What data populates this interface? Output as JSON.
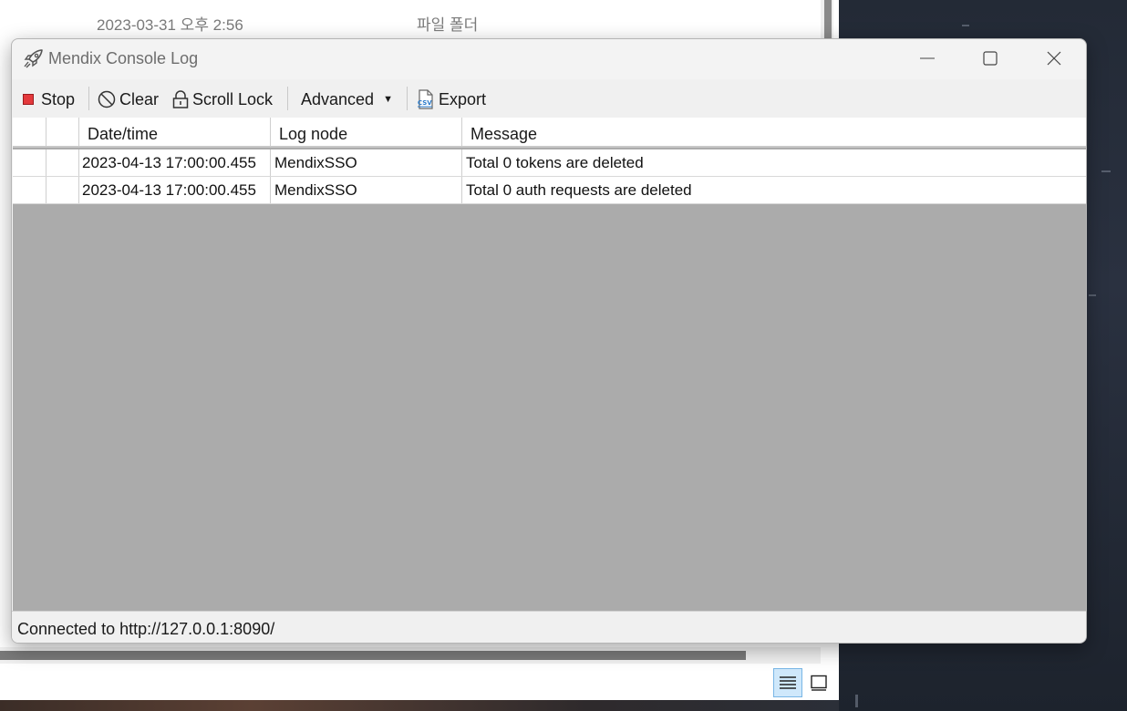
{
  "background": {
    "explorer_row": {
      "date": "2023-03-31 오후 2:56",
      "type": "파일 폴더"
    }
  },
  "window": {
    "title": "Mendix Console Log",
    "app_icon": "rocket-icon",
    "controls": {
      "minimize_icon": "minimize-icon",
      "maximize_icon": "maximize-icon",
      "close_icon": "close-icon"
    }
  },
  "toolbar": {
    "stop_label": "Stop",
    "clear_label": "Clear",
    "scroll_lock_label": "Scroll Lock",
    "advanced_label": "Advanced",
    "export_label": "Export",
    "export_icon_text": "CSV"
  },
  "grid": {
    "columns": [
      "Date/time",
      "Log node",
      "Message"
    ],
    "rows": [
      {
        "datetime": "2023-04-13 17:00:00.455",
        "node": "MendixSSO",
        "message": "Total 0 tokens are deleted"
      },
      {
        "datetime": "2023-04-13 17:00:00.455",
        "node": "MendixSSO",
        "message": "Total 0 auth requests are deleted"
      }
    ]
  },
  "status": {
    "text": "Connected to http://127.0.0.1:8090/"
  },
  "colors": {
    "stop": "#e4393c",
    "grid_empty": "#ababab",
    "accent": "#4a90d9"
  }
}
